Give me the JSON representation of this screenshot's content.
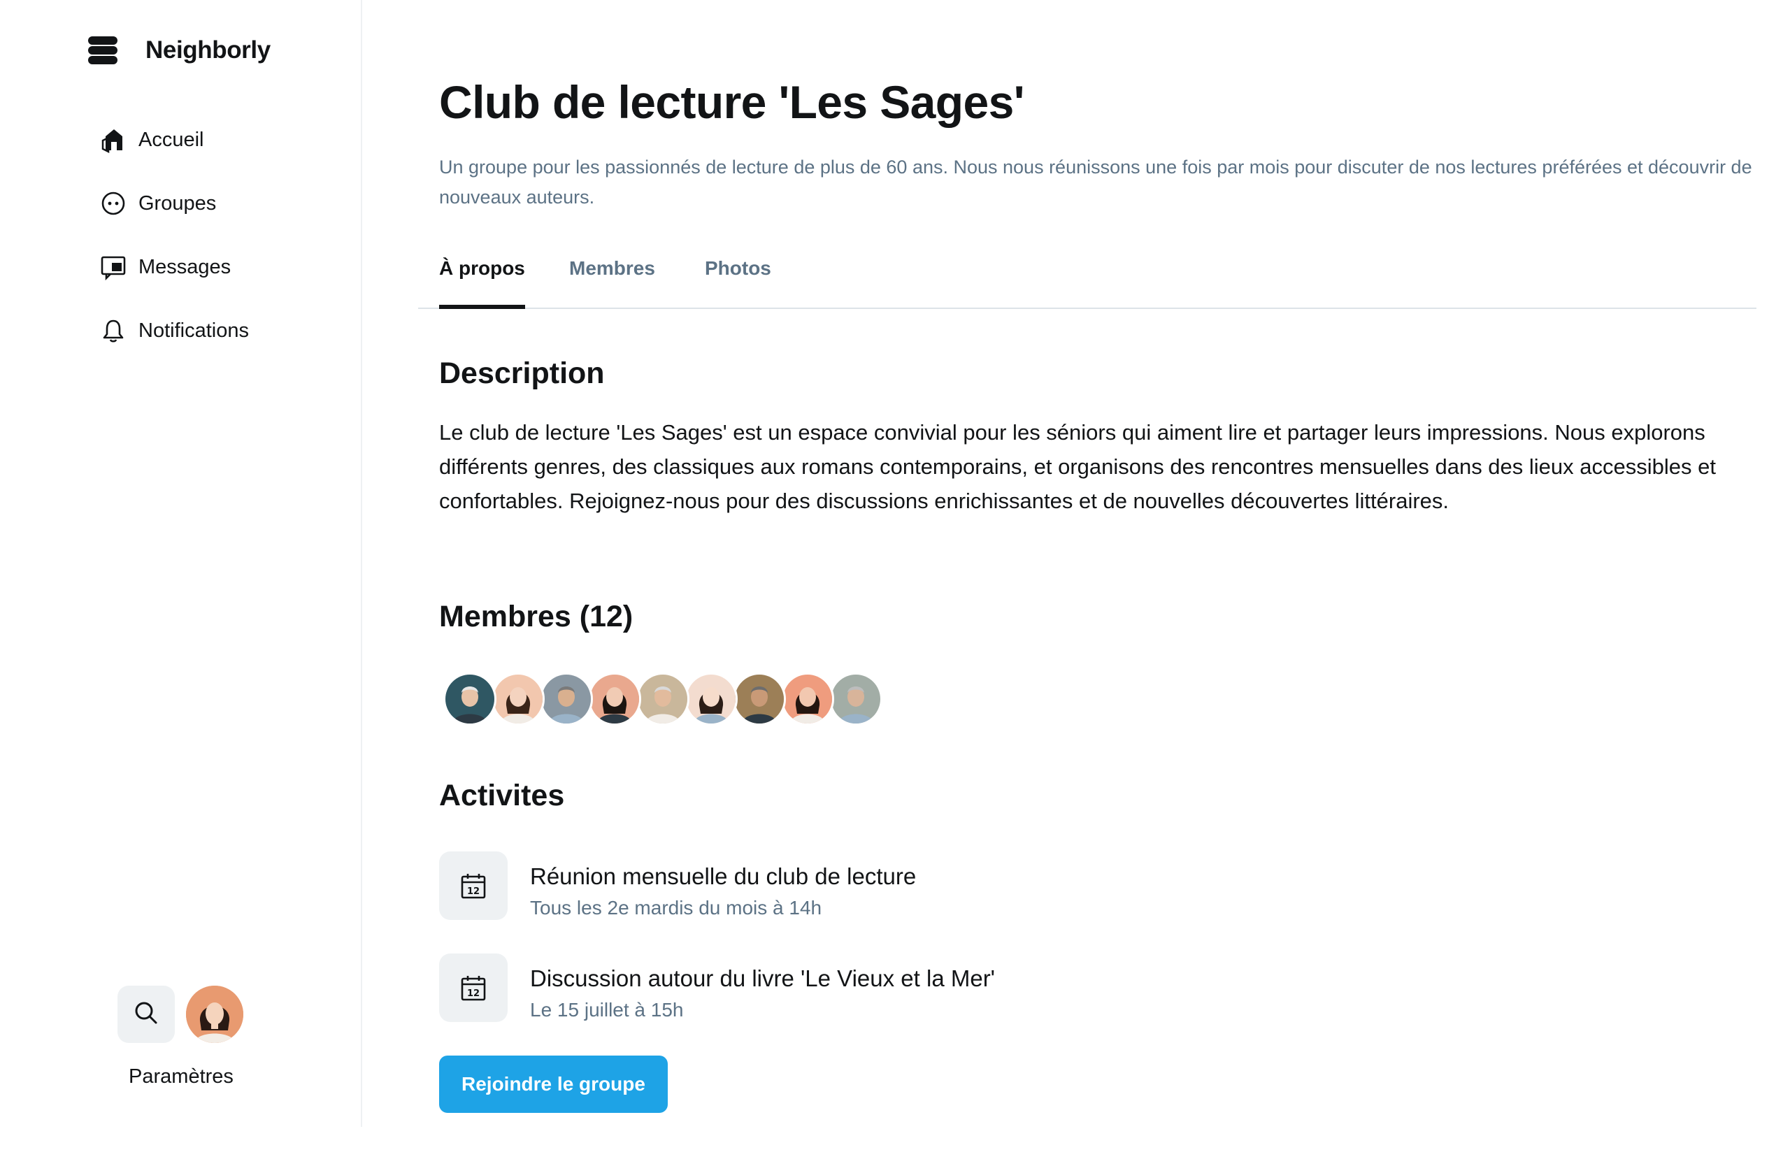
{
  "brand": {
    "name": "Neighborly",
    "icon": "stack-logo-icon"
  },
  "sidebar": {
    "items": [
      {
        "label": "Accueil",
        "icon": "home-icon"
      },
      {
        "label": "Groupes",
        "icon": "groups-icon"
      },
      {
        "label": "Messages",
        "icon": "messages-icon"
      },
      {
        "label": "Notifications",
        "icon": "bell-icon"
      }
    ],
    "settings_label": "Paramètres"
  },
  "group": {
    "title": "Club de lecture 'Les Sages'",
    "subtitle": "Un groupe pour les passionnés de lecture de plus de 60 ans. Nous nous réunissons une fois par mois pour discuter de nos lectures préférées et découvrir de nouveaux auteurs."
  },
  "tabs": [
    {
      "label": "À propos",
      "active": true
    },
    {
      "label": "Membres",
      "active": false
    },
    {
      "label": "Photos",
      "active": false
    }
  ],
  "description": {
    "heading": "Description",
    "body": "Le club de lecture 'Les Sages' est un espace convivial pour les séniors qui aiment lire et partager leurs impressions. Nous explorons différents genres, des classiques aux romans contemporains, et organisons des rencontres mensuelles dans des lieux accessibles et confortables. Rejoignez-nous pour des discussions enrichissantes et de nouvelles découvertes littéraires."
  },
  "members": {
    "heading": "Membres (12)",
    "avatar_colors": [
      "#2f5763",
      "#f2c7ae",
      "#8a98a3",
      "#e9a88e",
      "#c9b79b",
      "#f3dccf",
      "#9c7f57",
      "#ef9c7e",
      "#a2ada6"
    ]
  },
  "activities": {
    "heading": "Activites",
    "items": [
      {
        "title": "Réunion mensuelle du club de lecture",
        "subtitle": "Tous les 2e mardis du mois à 14h",
        "icon": "calendar-icon"
      },
      {
        "title": "Discussion autour du livre 'Le Vieux et la Mer'",
        "subtitle": "Le 15 juillet à 15h",
        "icon": "calendar-icon"
      }
    ]
  },
  "join_button": {
    "label": "Rejoindre le groupe"
  },
  "colors": {
    "accent": "#1ea3e6",
    "muted_text": "#5c7285",
    "surface": "#eef1f3"
  }
}
